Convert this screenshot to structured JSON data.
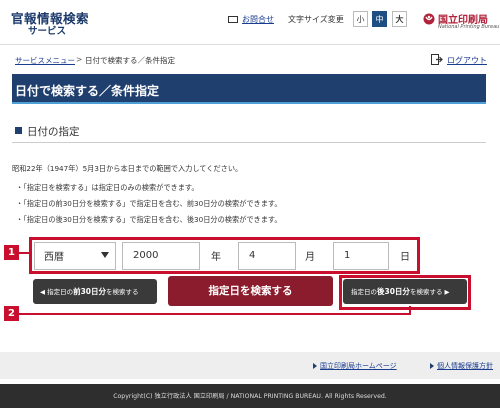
{
  "header": {
    "logo_main": "官報情報検索",
    "logo_sub": "サービス",
    "contact_link": "お問合せ",
    "font_size_label": "文字サイズ変更",
    "font_sizes": [
      "小",
      "中",
      "大"
    ],
    "selected_font_size": "中",
    "bureau_name": "国立印刷局",
    "bureau_sub": "National Printing Bureau",
    "accent_color": "#1f3f6f",
    "brand_color": "#b0233b"
  },
  "breadcrumb": {
    "link": "サービスメニュー",
    "separator": ">",
    "current": "日付で検索する／条件指定"
  },
  "logout": {
    "label": "ログアウト"
  },
  "page_title": "日付で検索する／条件指定",
  "section_title": "日付の指定",
  "intro": "昭和22年（1947年）5月3日から本日までの範囲で入力してください。",
  "bullets": [
    "・「指定日を検索する」は指定日のみの検索ができます。",
    "・「指定日の前30日分を検索する」で指定日を含む、前30日分の検索ができます。",
    "・「指定日の後30日分を検索する」で指定日を含む、後30日分の検索ができます。"
  ],
  "form": {
    "era": "西暦",
    "year": "2000",
    "year_unit": "年",
    "month": "4",
    "month_unit": "月",
    "day": "1",
    "day_unit": "日"
  },
  "markers": [
    "1",
    "2"
  ],
  "buttons": {
    "prev_prefix": "指定日の",
    "prev_emph": "前30日分",
    "prev_suffix": "を検索する",
    "search": "指定日を検索する",
    "next_prefix": "指定日の",
    "next_emph": "後30日分",
    "next_suffix": "を検索する"
  },
  "footer": {
    "links": [
      "国立印刷局ホームページ",
      "個人情報保護方針"
    ],
    "copyright": "Copyright(C) 独立行政法人 国立印刷局 / NATIONAL PRINTING BUREAU. All Rights Reserved."
  }
}
